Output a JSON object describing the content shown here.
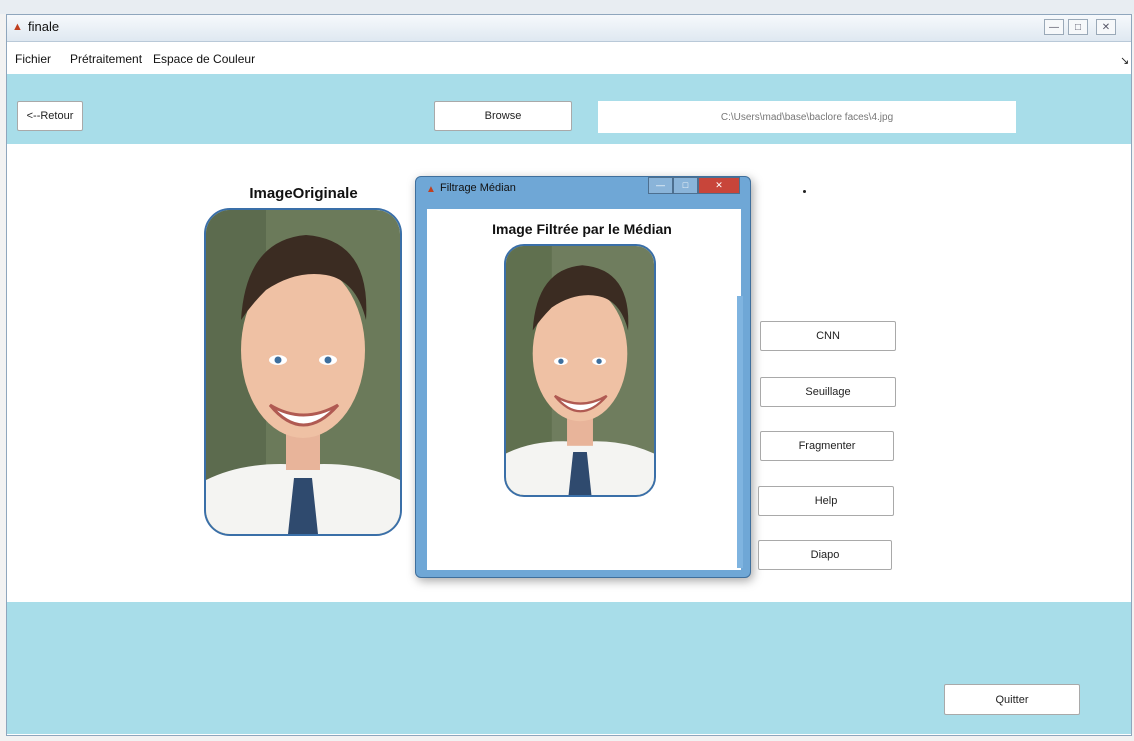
{
  "window": {
    "title": "finale"
  },
  "menu": {
    "items": [
      "Fichier",
      "Prétraitement",
      "Espace de Couleur"
    ]
  },
  "toolbar": {
    "back_label": "<--Retour",
    "browse_label": "Browse",
    "path_value": "C:\\Users\\mad\\base\\baclore faces\\4.jpg"
  },
  "labels": {
    "original": "ImageOriginale"
  },
  "dialog": {
    "title": "Filtrage Médian",
    "image_label": "Image Filtrée par le Médian"
  },
  "side_buttons": [
    "CNN",
    "Seuillage",
    "Fragmenter",
    "Help",
    "Diapo"
  ],
  "quit_label": "Quitter",
  "colors": {
    "band": "#a8dde9",
    "dialog_frame": "#6fa7d6",
    "photo_border": "#3a6fa8"
  },
  "icons": [
    "app-icon",
    "minimize-icon",
    "maximize-icon",
    "close-icon",
    "menu-corner-icon"
  ]
}
